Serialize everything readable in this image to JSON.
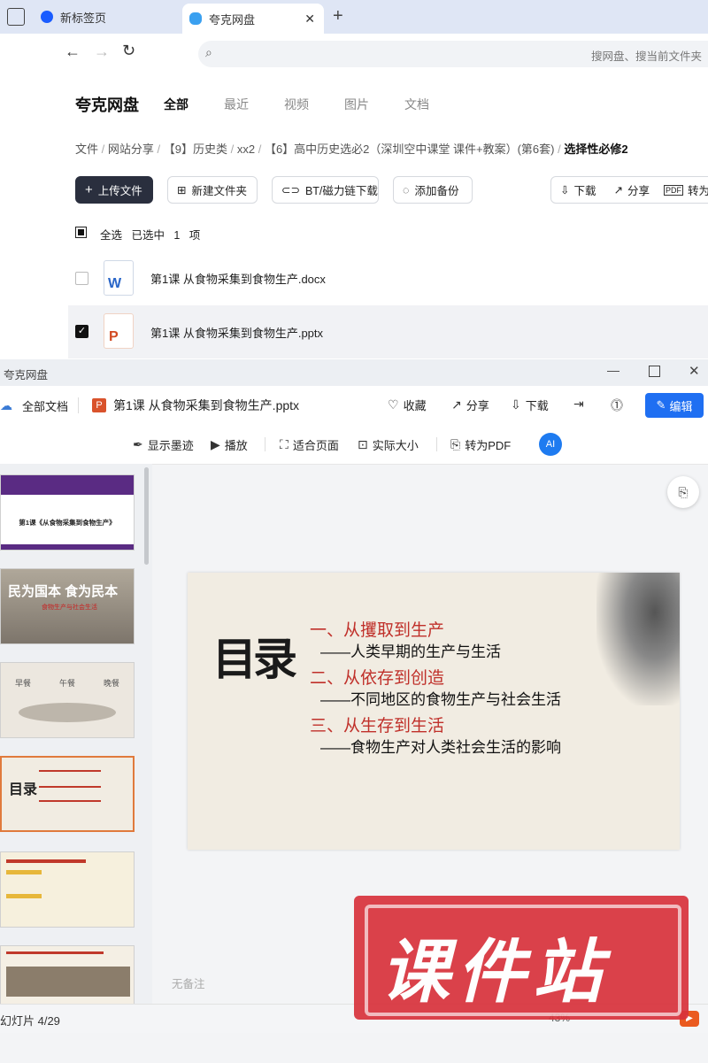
{
  "browser": {
    "tabs": [
      {
        "label": "新标签页"
      },
      {
        "label": "夸克网盘"
      }
    ],
    "address_placeholder": "搜网盘、搜当前文件夹"
  },
  "drive": {
    "brand": "夸克网盘",
    "nav": [
      "全部",
      "最近",
      "视频",
      "图片",
      "文档"
    ],
    "breadcrumb": [
      "文件",
      "网站分享",
      "【9】历史类",
      "xx2",
      "【6】高中历史选必2（深圳空中课堂 课件+教案）(第6套)",
      "选择性必修2"
    ],
    "buttons": {
      "upload": "上传文件",
      "new_folder": "新建文件夹",
      "bt": "BT/磁力链下载",
      "backup": "添加备份",
      "download": "下载",
      "share": "分享",
      "convert": "转为"
    },
    "selection": {
      "select_all": "全选",
      "selected": "已选中",
      "count": "1",
      "unit": "项"
    },
    "files": [
      {
        "name": "第1课 从食物采集到食物生产.docx",
        "type": "docx",
        "checked": false
      },
      {
        "name": "第1课 从食物采集到食物生产.pptx",
        "type": "pptx",
        "checked": true
      }
    ]
  },
  "viewer": {
    "window_title": "夸克网盘",
    "all_docs": "全部文档",
    "file_name": "第1课 从食物采集到食物生产.pptx",
    "actions": {
      "favorite": "收藏",
      "share": "分享",
      "download": "下载",
      "edit": "编辑"
    },
    "tools": {
      "ink": "显示墨迹",
      "play": "播放",
      "fit": "适合页面",
      "actual": "实际大小",
      "pdf": "转为PDF"
    },
    "no_notes": "无备注",
    "status": "幻灯片 4/29",
    "zoom": "43%",
    "thumbnails": {
      "t1_title": "第1课《从食物采集到食物生产》",
      "t2_title": "民为国本 食为民本",
      "t2_sub": "食物生产与社会生活",
      "t3_labels": [
        "早餐",
        "午餐",
        "晚餐"
      ]
    },
    "slide": {
      "heading": "目录",
      "items": [
        {
          "title": "一、从攫取到生产",
          "sub": "——人类早期的生产与生活"
        },
        {
          "title": "二、从依存到创造",
          "sub": "——不同地区的食物生产与社会生活"
        },
        {
          "title": "三、从生存到生活",
          "sub": "——食物生产对人类社会生活的影响"
        }
      ]
    }
  },
  "watermark": "课件站"
}
